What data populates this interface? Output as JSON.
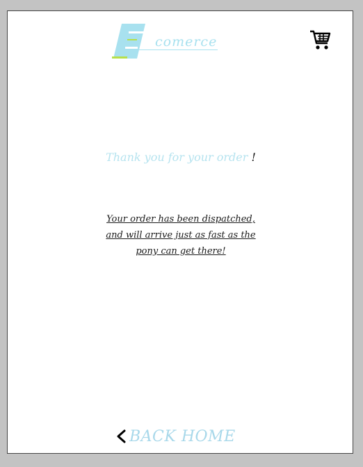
{
  "header": {
    "logo_text": "comerce",
    "logo_letter": "E",
    "cart_icon": "shopping-cart-icon"
  },
  "main": {
    "thanks_text": "Thank you for your order ",
    "thanks_mark": "!",
    "message_lines": [
      "Your order has been dispatched,",
      "and will arrive just as fast as the",
      "pony can get there!"
    ]
  },
  "footer": {
    "back_icon": "chevron-left-icon",
    "back_label": "BACK HOME"
  },
  "colors": {
    "accent_light_blue": "#a8e1ef",
    "accent_green": "#b6e04a",
    "text_dark": "#1a1a1a",
    "page_bg": "#ffffff",
    "window_bg": "#c3c3c3"
  }
}
